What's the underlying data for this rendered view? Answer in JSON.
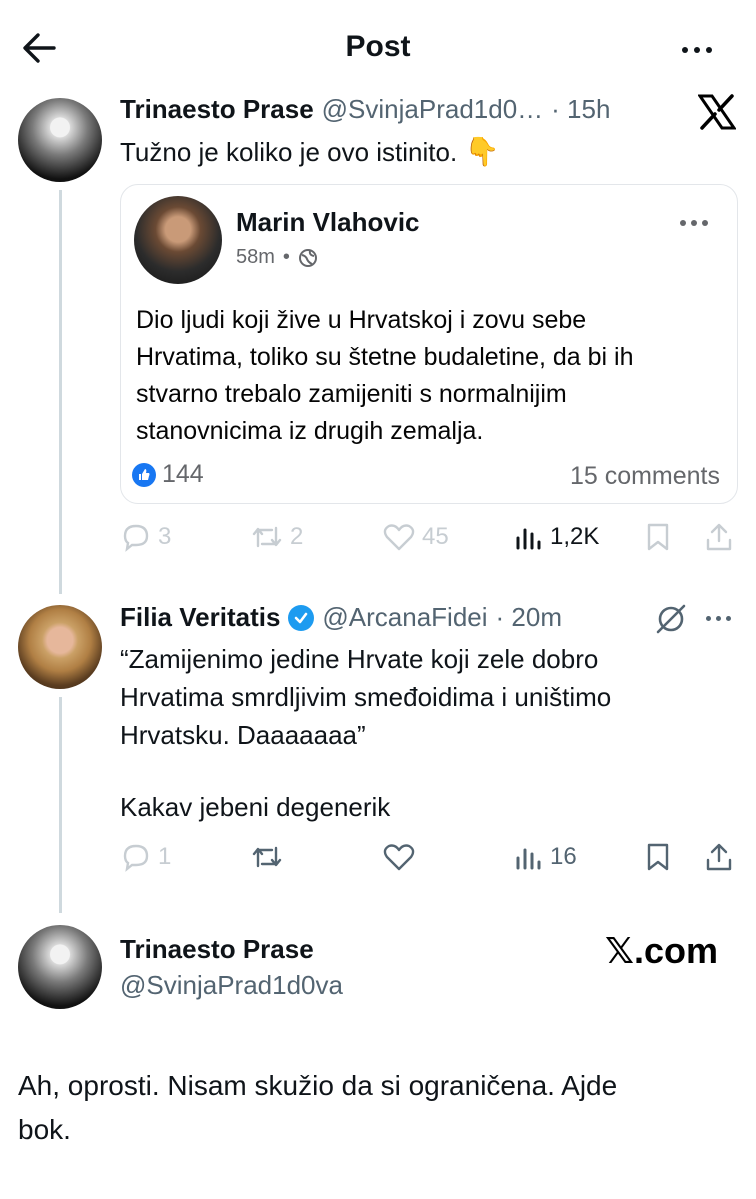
{
  "header": {
    "title": "Post"
  },
  "post1": {
    "author": "Trinaesto Prase",
    "handle": "@SvinjaPrad1d0…",
    "time": "· 15h",
    "text": "Tužno je koliko je ovo istinito.",
    "emoji": "👇",
    "embed": {
      "author": "Marin Vlahovic",
      "time": "58m",
      "dot": "•",
      "text_lines": [
        "Dio ljudi koji žive u Hrvatskoj i zovu sebe",
        "Hrvatima, toliko su štetne budaletine, da bi ih",
        "stvarno trebalo zamijeniti s normalnijim",
        "stanovnicima iz drugih zemalja."
      ],
      "likes": "144",
      "comments": "15 comments"
    },
    "stats": {
      "replies": "3",
      "reposts": "2",
      "likes": "45",
      "views": "1,2K"
    }
  },
  "post2": {
    "author": "Filia Veritatis",
    "handle": "@ArcanaFidei",
    "time": "· 20m",
    "text_lines": [
      "“Zamijenimo jedine Hrvate koji zele dobro",
      "Hrvatima smrdljivim smeđoidima i uništimo",
      "Hrvatsku. Daaaaaaa”"
    ],
    "text2": "Kakav jebeni degenerik",
    "stats": {
      "replies": "1",
      "views": "16"
    }
  },
  "post3": {
    "author": "Trinaesto Prase",
    "handle": "@SvinjaPrad1d0va",
    "brand": "𝕏.com",
    "text_lines": [
      "Ah, oprosti. Nisam skužio da si ograničena. Ajde",
      "bok."
    ]
  }
}
